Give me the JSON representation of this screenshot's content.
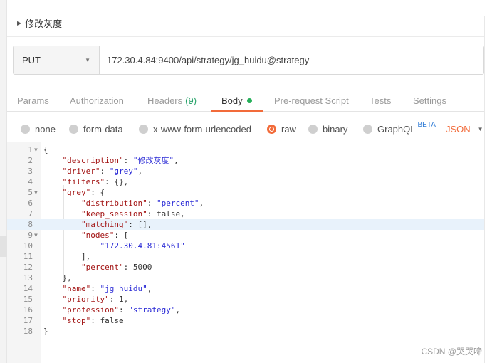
{
  "request": {
    "title": "修改灰度"
  },
  "url_bar": {
    "method": "PUT",
    "url": "172.30.4.84:9400/api/strategy/jg_huidu@strategy"
  },
  "tabs": [
    {
      "label": "Params"
    },
    {
      "label": "Authorization"
    },
    {
      "label": "Headers",
      "count": "(9)"
    },
    {
      "label": "Body",
      "active": true
    },
    {
      "label": "Pre-request Script"
    },
    {
      "label": "Tests"
    },
    {
      "label": "Settings"
    }
  ],
  "body_types": [
    {
      "label": "none"
    },
    {
      "label": "form-data"
    },
    {
      "label": "x-www-form-urlencoded"
    },
    {
      "label": "raw",
      "selected": true
    },
    {
      "label": "binary"
    },
    {
      "label": "GraphQL",
      "badge": "BETA"
    }
  ],
  "format_select": {
    "value": "JSON"
  },
  "editor": {
    "active_line": 8,
    "lines": [
      {
        "n": "1",
        "fold": true,
        "text": "{"
      },
      {
        "n": "2",
        "text": "    \"description\": \"修改灰度\","
      },
      {
        "n": "3",
        "text": "    \"driver\": \"grey\","
      },
      {
        "n": "4",
        "text": "    \"filters\": {},"
      },
      {
        "n": "5",
        "fold": true,
        "text": "    \"grey\": {"
      },
      {
        "n": "6",
        "text": "        \"distribution\": \"percent\","
      },
      {
        "n": "7",
        "text": "        \"keep_session\": false,"
      },
      {
        "n": "8",
        "text": "        \"matching\": [],"
      },
      {
        "n": "9",
        "fold": true,
        "text": "        \"nodes\": ["
      },
      {
        "n": "10",
        "text": "            \"172.30.4.81:4561\""
      },
      {
        "n": "11",
        "text": "        ],"
      },
      {
        "n": "12",
        "text": "        \"percent\": 5000"
      },
      {
        "n": "13",
        "text": "    },"
      },
      {
        "n": "14",
        "text": "    \"name\": \"jg_huidu\","
      },
      {
        "n": "15",
        "text": "    \"priority\": 1,"
      },
      {
        "n": "16",
        "text": "    \"profession\": \"strategy\","
      },
      {
        "n": "17",
        "text": "    \"stop\": false"
      },
      {
        "n": "18",
        "text": "}"
      }
    ]
  },
  "watermark": "CSDN @哭哭啼",
  "colors": {
    "accent": "#f26b3a",
    "tab_dot": "#26b05a",
    "count": "#26a269",
    "json_key": "#a31515",
    "json_string": "#2b2bd6"
  }
}
